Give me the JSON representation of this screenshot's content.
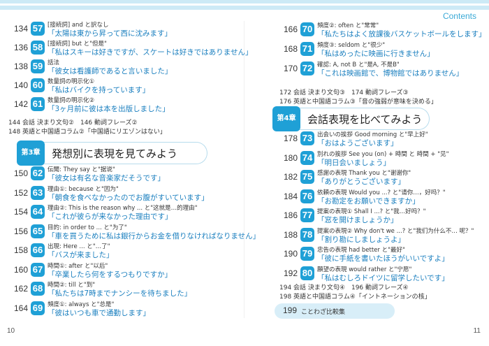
{
  "header": {
    "contents": "Contents"
  },
  "page_numbers": {
    "left": "10",
    "right": "11"
  },
  "left_top": [
    {
      "page": "134",
      "num": "57",
      "label": "[接続詞] and と訳なし",
      "main": "太陽は東から昇って西に沈みます"
    },
    {
      "page": "136",
      "num": "58",
      "label": "[接続詞] but と\"但是\"",
      "main": "私はスキーは好きですが、スケートは好きではありません"
    },
    {
      "page": "138",
      "num": "59",
      "label": "話法",
      "main": "彼女は看護師であると言いました"
    },
    {
      "page": "140",
      "num": "60",
      "label": "数量詞の明示化①",
      "main": "私はバイクを持っています"
    },
    {
      "page": "142",
      "num": "61",
      "label": "数量詞の明示化②",
      "main": "3ヶ月前に彼は本を出版しました"
    }
  ],
  "left_misc": [
    {
      "text": "144 会話 決まり文句②　146 動詞フレーズ②"
    },
    {
      "text": "148 英語と中国語コラム②「中国語にリエゾンはない」"
    }
  ],
  "section3": {
    "tag": "第3章",
    "title": "発想別に表現を見てみよう"
  },
  "left_bottom": [
    {
      "page": "150",
      "num": "62",
      "label": "伝聞: They say と\"据说\"",
      "main": "彼女は有名な音楽家だそうです"
    },
    {
      "page": "152",
      "num": "63",
      "label": "理由①: because と\"因为\"",
      "main": "朝食を食べなかったのでお腹がすいています"
    },
    {
      "page": "154",
      "num": "64",
      "label": "理由②: This is the reason why ... と\"这就是…的理由\"",
      "main": "これが彼らが来なかった理由です"
    },
    {
      "page": "156",
      "num": "65",
      "label": "目的: in order to ... と\"为了\"",
      "main": "車を買うために私は銀行からお金を借りなければなりません"
    },
    {
      "page": "158",
      "num": "66",
      "label": "出現: Here ... と\"…了\"",
      "main": "バスが来ました"
    },
    {
      "page": "160",
      "num": "67",
      "label": "時間①: after と\"以后\"",
      "main": "卒業したら何をするつもりですか"
    },
    {
      "page": "162",
      "num": "68",
      "label": "時間②: till と\"到\"",
      "main": "私たちは7時までナンシーを待ちました"
    },
    {
      "page": "164",
      "num": "69",
      "label": "頻度①: always と\"总是\"",
      "main": "彼はいつも車で通勤します"
    }
  ],
  "right_top": [
    {
      "page": "166",
      "num": "70",
      "label": "頻度②: often と\"常常\"",
      "main": "私たちはよく放課後バスケットボールをします"
    },
    {
      "page": "168",
      "num": "71",
      "label": "頻度③: seldom と\"很少\"",
      "main": "私はめったに映画に行きません"
    },
    {
      "page": "170",
      "num": "72",
      "label": "確認: A, not B と\"是A, 不是B\"",
      "main": "これは映画館で、博物館ではありません"
    }
  ],
  "right_misc": [
    {
      "text": "172 会話 決まり文句③　174 動詞フレーズ③"
    },
    {
      "text": "176 英語と中国語コラム③「音の強弱が意味を決める」"
    }
  ],
  "section4": {
    "tag": "第4章",
    "title": "会話表現を比べてみよう"
  },
  "right_bottom": [
    {
      "page": "178",
      "num": "73",
      "label": "出会いの挨拶 Good morning と\"早上好\"",
      "main": "おはようございます"
    },
    {
      "page": "180",
      "num": "74",
      "label": "別れの挨拶 See you (on) + 時間 と 時間 + \"见\"",
      "main": "明日会いましょう"
    },
    {
      "page": "182",
      "num": "75",
      "label": "感謝の表現 Thank you と\"谢谢你\"",
      "main": "ありがとうございます"
    },
    {
      "page": "184",
      "num": "76",
      "label": "依頼の表現 Would you ...? と\"请你…，好吗？\"",
      "main": "お勘定をお願いできますか"
    },
    {
      "page": "186",
      "num": "77",
      "label": "提案の表現① Shall I ...? と\"我…好吗？\"",
      "main": "窓を開けましょうか"
    },
    {
      "page": "188",
      "num": "78",
      "label": "提案の表現② Why don't we ...? と\"我们为什么不… 呢？\"",
      "main": "割り勘にしましょうよ"
    },
    {
      "page": "190",
      "num": "79",
      "label": "忠告の表現 had better と\"最好\"",
      "main": "彼に手紙を書いたほうがいいですよ"
    },
    {
      "page": "192",
      "num": "80",
      "label": "願望の表現 would rather と\"宁愿\"",
      "main": "私はむしろドイツに留学したいです"
    }
  ],
  "right_misc2": [
    {
      "text": "194 会話 決まり文句④　196 動詞フレーズ④"
    },
    {
      "text": "198 英語と中国語コラム④「イントネーションの核」"
    }
  ],
  "kotowaza": {
    "num": "199",
    "text": "ことわざ比較集"
  }
}
